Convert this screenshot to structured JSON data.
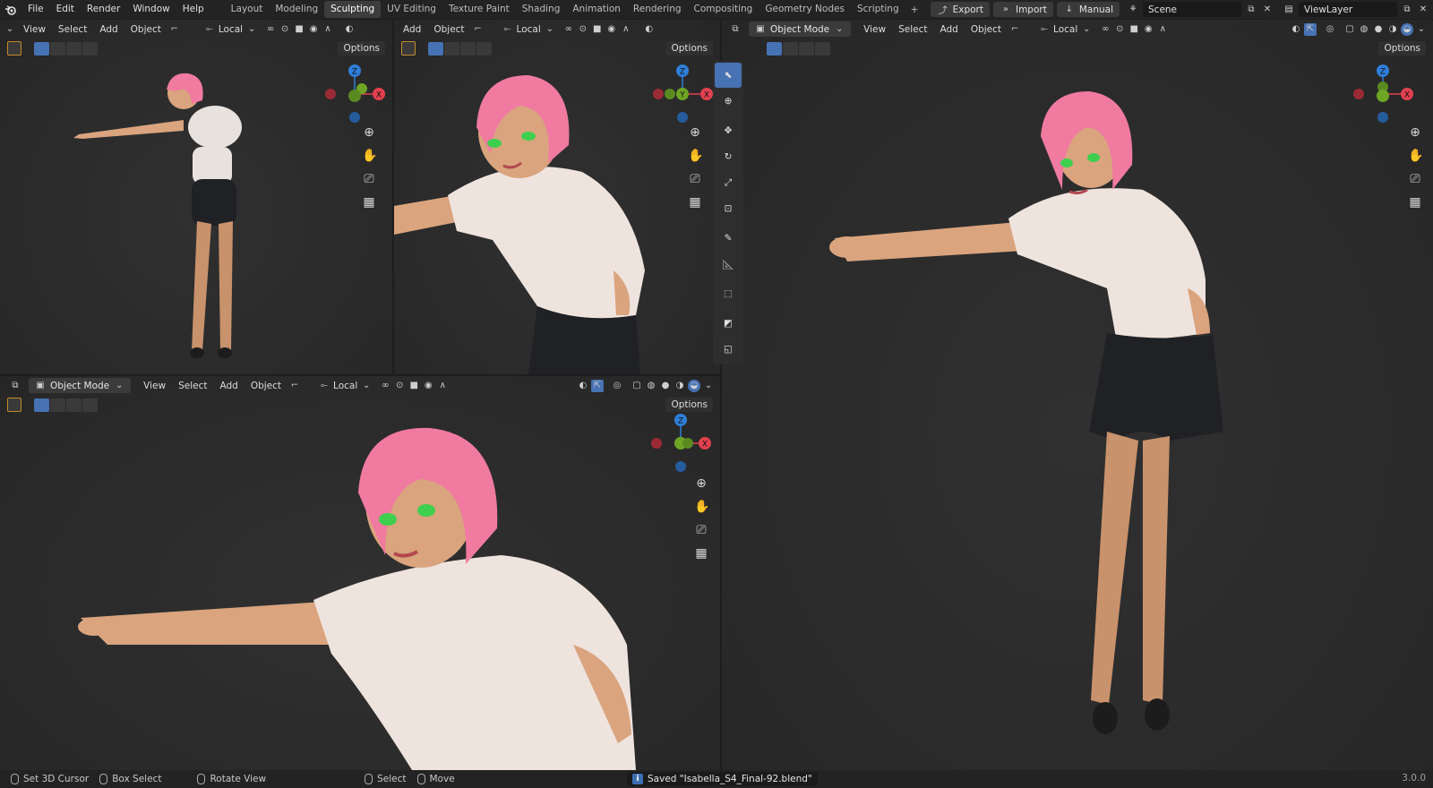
{
  "topbar": {
    "menus": [
      "File",
      "Edit",
      "Render",
      "Window",
      "Help"
    ],
    "workspaces": [
      "Layout",
      "Modeling",
      "Sculpting",
      "UV Editing",
      "Texture Paint",
      "Shading",
      "Animation",
      "Rendering",
      "Compositing",
      "Geometry Nodes",
      "Scripting"
    ],
    "active_workspace": "Sculpting",
    "export_label": "Export",
    "import_label": "Import",
    "manual_label": "Manual",
    "scene_value": "Scene",
    "viewlayer_value": "ViewLayer"
  },
  "viewport": {
    "mode_label": "Object Mode",
    "menu_view": "View",
    "menu_select": "Select",
    "menu_add": "Add",
    "menu_object": "Object",
    "transform_orientation": "Local",
    "options_label": "Options"
  },
  "gizmo": {
    "z": "Z",
    "y": "Y",
    "x": "X"
  },
  "colors": {
    "accent": "#4772b3",
    "x_axis": "#e2414f",
    "y_axis": "#6ea524",
    "z_axis": "#2f7ed8",
    "hair": "#f07aa0",
    "skin": "#d9a47e",
    "shirt": "#f2e4df",
    "shorts": "#202125"
  },
  "statusbar": {
    "set_cursor": "Set 3D Cursor",
    "box_select": "Box Select",
    "rotate_view": "Rotate View",
    "select": "Select",
    "move": "Move",
    "saved_message": "Saved \"Isabella_S4_Final-92.blend\"",
    "version": "3.0.0"
  }
}
